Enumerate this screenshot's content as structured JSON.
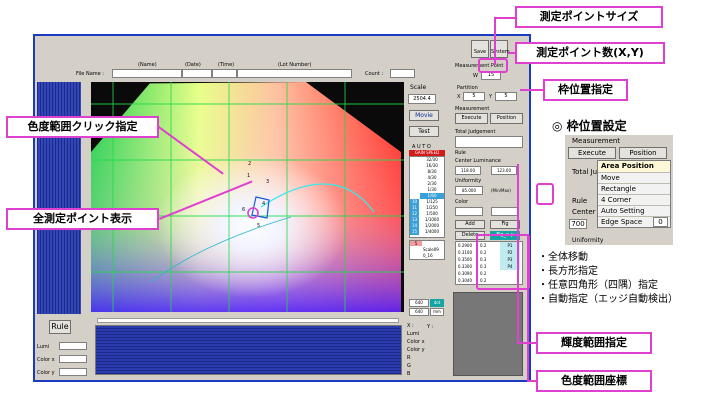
{
  "header": {
    "col_labels": [
      "(Name)",
      "(Date)",
      "(Time)",
      "(Lot Number)"
    ],
    "file_name_label": "File Name :",
    "count_label": "Count :"
  },
  "toolbar": {
    "save": "Save",
    "system": "System"
  },
  "measurement_point": {
    "label": "Measurement Point",
    "w_label": "W",
    "w_value": "15"
  },
  "partition": {
    "label": "Partition",
    "x_label": "X",
    "x_value": "5",
    "y_label": "Y",
    "y_value": "5"
  },
  "measurement": {
    "label": "Measurement",
    "execute": "Execute",
    "position": "Position"
  },
  "total_judgement": "Total Judgement",
  "scale": {
    "label": "Scale",
    "value": "2504.4"
  },
  "side_buttons": {
    "movie": "Movie",
    "test": "Test"
  },
  "auto": {
    "title": "A U T O",
    "header": "GAIN SPEED",
    "values": [
      "32/30",
      "16/30",
      "8/30",
      "4/30",
      "2/30",
      "1/30",
      "1/60",
      "1/125",
      "1/250",
      "1/500",
      "1/1000",
      "1/2000",
      "1/4000"
    ],
    "gains": [
      "",
      "",
      "",
      "",
      "",
      "",
      "",
      "10",
      "11",
      "12",
      "13",
      "14",
      "15"
    ],
    "extra": [
      "5",
      "Scale09",
      "0_16"
    ],
    "val_640a": "640",
    "val_640b": "640",
    "dot": "dot",
    "mm": "mm"
  },
  "rule": {
    "label": "Rule",
    "center_luminance": "Center Luminance",
    "lum_low": "118.00",
    "lum_high": "123.00",
    "uniformity": "Uniformity",
    "uniformity_value": "85.000",
    "minmax": "(Min/Max)",
    "color": "Color",
    "add": "Add",
    "fig": "Fig",
    "delete": "Delete",
    "fig_xy": "Fig_x-y",
    "coords": [
      {
        "x": "0.2900",
        "y": "0.2"
      },
      {
        "x": "0.3100",
        "y": "0.2"
      },
      {
        "x": "0.3500",
        "y": "0.3"
      },
      {
        "x": "0.3300",
        "y": "0.3"
      },
      {
        "x": "0.3090",
        "y": "0.2"
      },
      {
        "x": "0.3040",
        "y": "0.2"
      }
    ],
    "pt_nums": [
      "P1",
      "P2",
      "P3",
      "P4",
      "",
      ""
    ]
  },
  "bottom": {
    "rule_btn": "Rule",
    "lumi": "Lumi",
    "color_x": "Color x",
    "color_y": "Color y",
    "readout": [
      "X :",
      "Lumi",
      "Color x",
      "Color y",
      "R",
      "G",
      "B"
    ],
    "readout_y": "Y :"
  },
  "chart_labels": {
    "p1": "1",
    "p2": "2",
    "p3": "3",
    "p4": "4",
    "p5": "5",
    "p6": "6"
  },
  "callouts": {
    "point_size": "測定ポイントサイズ",
    "point_count": "測定ポイント数(X,Y)",
    "frame_position": "枠位置指定",
    "chroma_click": "色度範囲クリック指定",
    "all_points": "全測定ポイント表示",
    "luminance_range": "輝度範囲指定",
    "chroma_coords": "色度範囲座標"
  },
  "frame_setting": {
    "title": "◎ 枠位置設定",
    "measurement": "Measurement",
    "execute": "Execute",
    "position": "Position",
    "total_j": "Total Ju",
    "rule": "Rule",
    "center_l": "Center L",
    "center_value": "700",
    "uniformity": "Uniformity",
    "menu": [
      "Area Position",
      "Move",
      "Rectangle",
      "4 Corner",
      "Auto Setting",
      "Edge Space"
    ],
    "edge_value": "0"
  },
  "bullets": [
    "・全体移動",
    "・長方形指定",
    "・任意四角形（四隅）指定",
    "・自動指定（エッジ自動検出）"
  ],
  "colors": {
    "window_border": "#1a3bbf",
    "callout_border": "#e040d0",
    "plot_bg": "#0a0a0a",
    "strip_blue": "#1c2a8c"
  }
}
